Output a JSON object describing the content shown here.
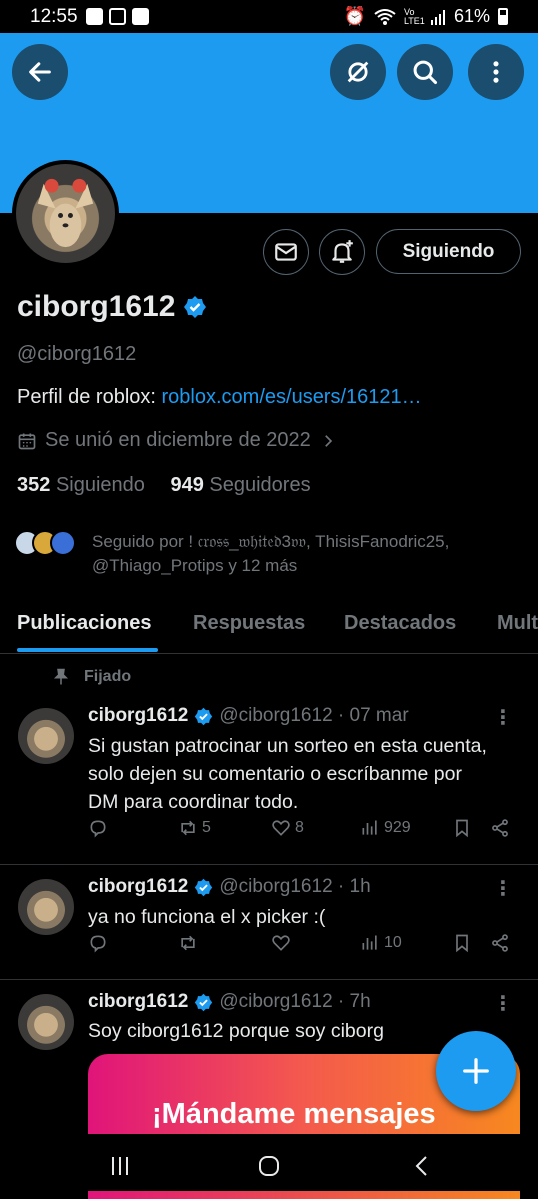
{
  "status_bar": {
    "time": "12:55",
    "network": "Vo LTE1",
    "battery": "61%"
  },
  "profile": {
    "name": "ciborg1612",
    "handle": "@ciborg1612",
    "bio_prefix": "Perfil de roblox: ",
    "bio_link": "roblox.com/es/users/16121…",
    "joined": "Se unió en diciembre de 2022",
    "following_count": "352",
    "following_label": "Siguiendo",
    "followers_count": "949",
    "followers_label": "Seguidores",
    "followed_by": "Seguido por ! 𝔠𝔯𝔬𝔰𝔰_𝔴𝔥𝔦𝔱𝔢𝔡3𝔳𝔳, ThisisFanodric25, @Thiago_Protips y 12 más",
    "follow_button": "Siguiendo"
  },
  "tabs": [
    "Publicaciones",
    "Respuestas",
    "Destacados",
    "Mult"
  ],
  "pinned_label": "Fijado",
  "posts": [
    {
      "name": "ciborg1612",
      "meta": "@ciborg1612 · 07 mar",
      "text": "Si gustan patrocinar un sorteo en esta cuenta, solo dejen su comentario o escríbanme por DM para coordinar todo.",
      "replies": "",
      "reposts": "5",
      "likes": "8",
      "views": "929"
    },
    {
      "name": "ciborg1612",
      "meta": "@ciborg1612 · 1h",
      "text": "ya no funciona el x picker :(",
      "replies": "",
      "reposts": "",
      "likes": "",
      "views": "10"
    },
    {
      "name": "ciborg1612",
      "meta": "@ciborg1612 · 7h",
      "text": "Soy ciborg1612 porque soy ciborg",
      "media_text": "¡Mándame mensajes"
    }
  ],
  "colors": {
    "accent": "#1d9bf0",
    "banner": "#1d9bf0",
    "background": "#000000",
    "muted": "#71767b"
  },
  "icons": [
    "back-arrow-icon",
    "no-signal-icon",
    "search-icon",
    "more-vertical-icon",
    "mail-icon",
    "bell-plus-icon",
    "verified-icon",
    "calendar-icon",
    "chevron-right-icon",
    "pin-icon",
    "reply-icon",
    "repost-icon",
    "like-icon",
    "views-icon",
    "bookmark-icon",
    "share-icon",
    "plus-icon"
  ]
}
